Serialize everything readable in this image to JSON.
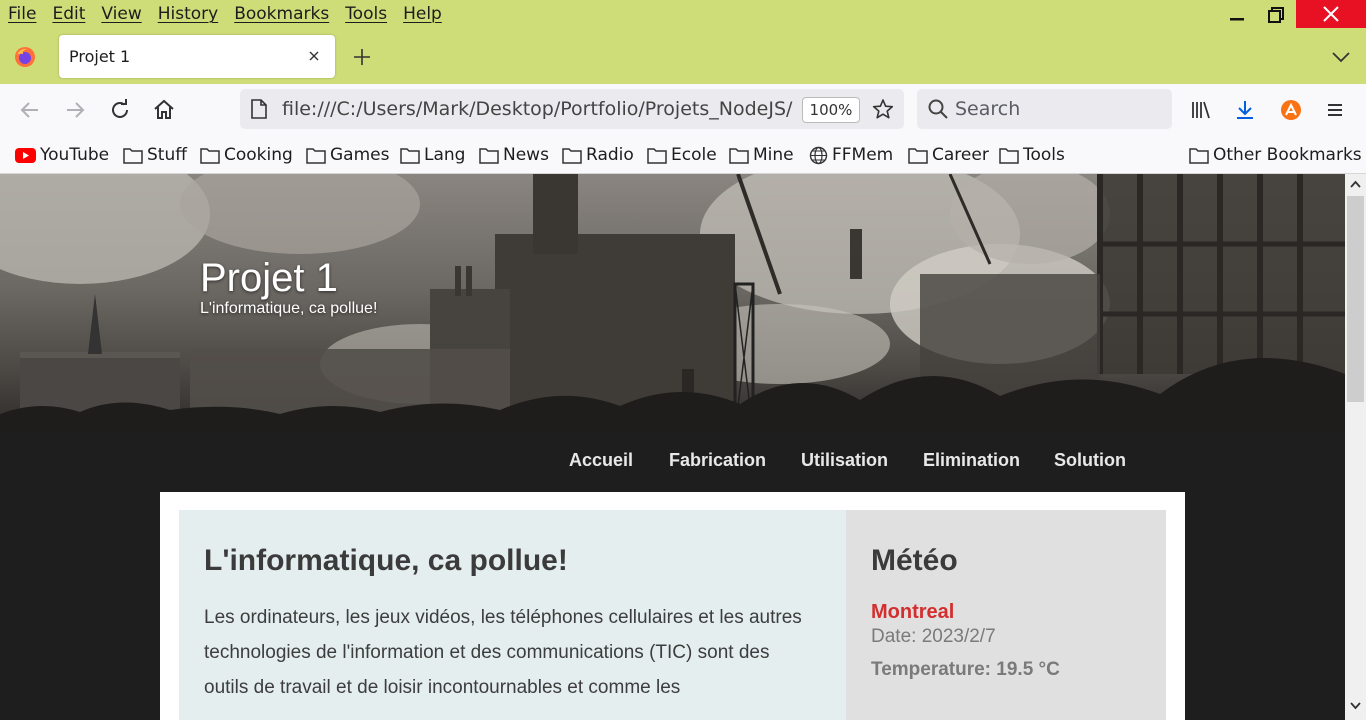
{
  "menubar": {
    "items": [
      "File",
      "Edit",
      "View",
      "History",
      "Bookmarks",
      "Tools",
      "Help"
    ]
  },
  "tab": {
    "title": "Projet 1"
  },
  "navbar": {
    "url": "file:///C:/Users/Mark/Desktop/Portfolio/Projets_NodeJS/",
    "zoom": "100%",
    "search_placeholder": "Search"
  },
  "bookmarks": [
    {
      "label": "YouTube",
      "icon": "youtube-icon"
    },
    {
      "label": "Stuff",
      "icon": "folder-icon"
    },
    {
      "label": "Cooking",
      "icon": "folder-icon"
    },
    {
      "label": "Games",
      "icon": "folder-icon"
    },
    {
      "label": "Lang",
      "icon": "folder-icon"
    },
    {
      "label": "News",
      "icon": "folder-icon"
    },
    {
      "label": "Radio",
      "icon": "folder-icon"
    },
    {
      "label": "Ecole",
      "icon": "folder-icon"
    },
    {
      "label": "Mine",
      "icon": "folder-icon"
    },
    {
      "label": "FFMem",
      "icon": "globe-icon"
    },
    {
      "label": "Career",
      "icon": "folder-icon"
    },
    {
      "label": "Tools",
      "icon": "folder-icon"
    }
  ],
  "other_bookmarks": "Other Bookmarks",
  "page": {
    "hero_title": "Projet 1",
    "hero_subtitle": "L'informatique, ca pollue!",
    "nav": [
      "Accueil",
      "Fabrication",
      "Utilisation",
      "Elimination",
      "Solution"
    ],
    "main_heading": "L'informatique, ca pollue!",
    "main_paragraph": "Les ordinateurs, les jeux vidéos, les téléphones cellulaires et les autres technologies de l'information et des communications (TIC) sont des outils de travail et de loisir incontournables et comme les",
    "sidebar_heading": "Météo",
    "weather": {
      "city": "Montreal",
      "date": "Date: 2023/2/7",
      "temperature": "Temperature: 19.5 °C"
    }
  },
  "colors": {
    "chrome": "#cedd78",
    "close": "#e81123",
    "accent_red": "#d32f2f"
  }
}
